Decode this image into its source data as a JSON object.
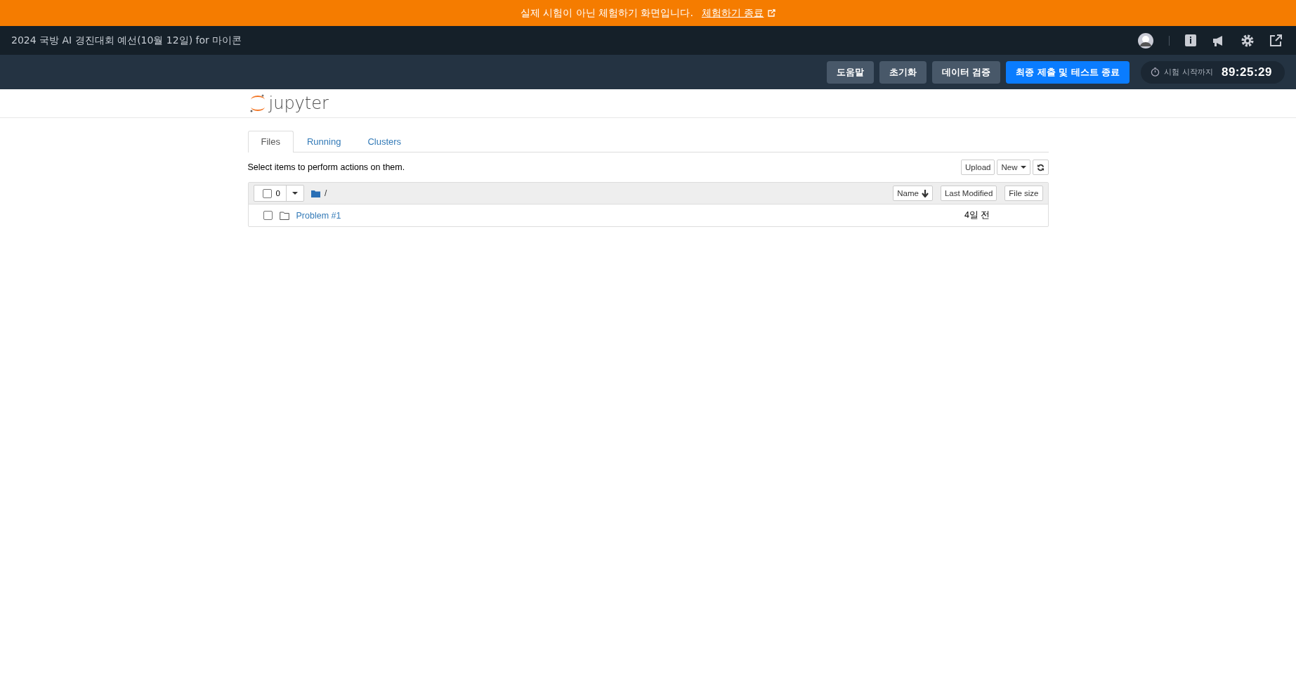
{
  "banner": {
    "message": "실제 시험이 아닌 체험하기 화면입니다.",
    "link": "체험하기 종료"
  },
  "header": {
    "title": "2024 국방 AI 경진대회 예선(10월 12일) for 마이콘"
  },
  "actions": [
    {
      "label": "도움말",
      "kind": "secondary"
    },
    {
      "label": "초기화",
      "kind": "secondary"
    },
    {
      "label": "데이터 검증",
      "kind": "secondary"
    },
    {
      "label": "최종 제출 및 테스트 종료",
      "kind": "primary"
    }
  ],
  "timer": {
    "label": "시험 시작까지",
    "value": "89:25:29"
  },
  "logo": {
    "text": "jupyter"
  },
  "tabs": [
    {
      "label": "Files",
      "selected": true
    },
    {
      "label": "Running",
      "selected": false
    },
    {
      "label": "Clusters",
      "selected": false
    }
  ],
  "hint": "Select items to perform actions on them.",
  "toolbar": [
    "Upload",
    "New"
  ],
  "list_header": {
    "selected_count": "0",
    "checked": false,
    "path": "/",
    "sort_buttons": [
      "Name",
      "Last Modified",
      "File size"
    ]
  },
  "rows": [
    {
      "name": "Problem #1",
      "modified": "4일 전",
      "checked": false
    }
  ]
}
